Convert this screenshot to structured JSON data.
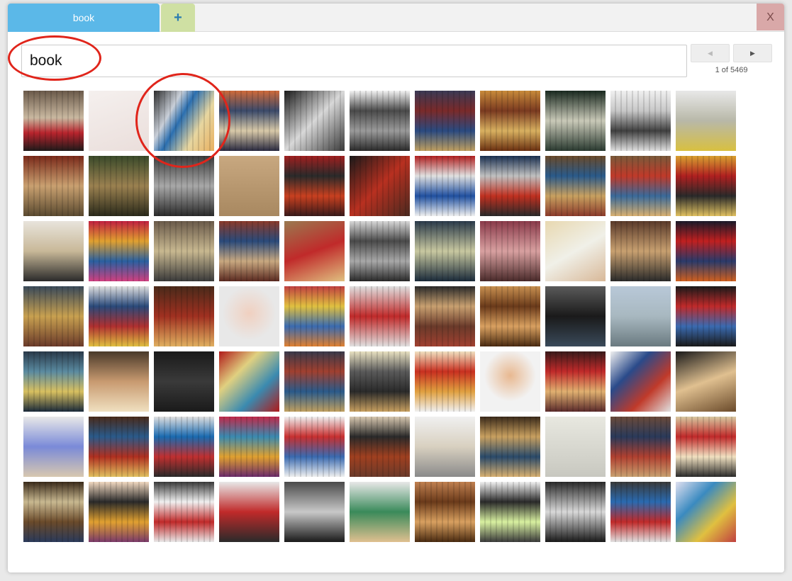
{
  "tabs": {
    "active_label": "book",
    "add_label": "+"
  },
  "close_label": "X",
  "search": {
    "value": "book",
    "placeholder": ""
  },
  "pagination": {
    "prev_label": "◀",
    "next_label": "▶",
    "counter": "1 of 5469"
  },
  "thumbnails": [
    {
      "bg": "linear-gradient(180deg,#6b5a4a 0%,#c9b8a0 45%,#b8242d 70%,#1f1a1a 100%)"
    },
    {
      "bg": "linear-gradient(160deg,#f5f0ee,#eadedb)",
      "plain": true
    },
    {
      "bg": "linear-gradient(120deg,#2a2a2a 0%,#c9cfd8 30%,#2b6fb0 45%,#e7d6a0 70%,#e8b060 100%)"
    },
    {
      "bg": "linear-gradient(180deg,#cf6a3a,#3b4a6a,#d8c9a8,#2a2a40)"
    },
    {
      "bg": "linear-gradient(135deg,#1a1a1a,#d8d8d8,#3a3a3a)"
    },
    {
      "bg": "linear-gradient(180deg,#f2f2f2,#4a4a4a,#9a9a9a,#2a2a2a)"
    },
    {
      "bg": "linear-gradient(180deg,#3b3a55,#7a2a2a,#2a4a80,#c0a060)"
    },
    {
      "bg": "linear-gradient(180deg,#c88a3a,#7a3a20,#d8b060,#6a3010)"
    },
    {
      "bg": "linear-gradient(180deg,#1a2a20,#c9c9b8,#2a3a30)"
    },
    {
      "bg": "linear-gradient(180deg,#f0f0f0,#c8c8c8,#404040,#e0e0e0)"
    },
    {
      "bg": "linear-gradient(180deg,#e8e8e8,#b8b8a8,#d8c040)",
      "plain": true
    },
    {
      "bg": "linear-gradient(180deg,#7a2a1a,#c9a070,#5a4a30)"
    },
    {
      "bg": "linear-gradient(180deg,#3a4a2a,#9a8050,#2a2a1a)"
    },
    {
      "bg": "linear-gradient(180deg,#3a3a3a,#a8a8a8,#2a2a2a)"
    },
    {
      "bg": "linear-gradient(180deg,#c8a880,#a88860)",
      "plain": true
    },
    {
      "bg": "linear-gradient(180deg,#a02020,#2a2a2a,#c84020,#3a1a1a)"
    },
    {
      "bg": "linear-gradient(135deg,#1a1a1a,#b83020,#4a2a20)"
    },
    {
      "bg": "linear-gradient(180deg,#b02020,#e0e0e0,#2050a0,#f0f0f0)"
    },
    {
      "bg": "linear-gradient(180deg,#1a3050,#c0c0c0,#c03020,#2a2a2a)"
    },
    {
      "bg": "linear-gradient(180deg,#6a4a2a,#2a5a8a,#c8a060,#8a3a2a)"
    },
    {
      "bg": "linear-gradient(180deg,#7a5a3a,#c03a2a,#3a6a9a,#d8b070)"
    },
    {
      "bg": "linear-gradient(180deg,#d8a030,#b02020,#2a2a2a,#e0c060)"
    },
    {
      "bg": "linear-gradient(180deg,#e8e4dc,#c8b898,#2a2a2a)",
      "plain": true
    },
    {
      "bg": "linear-gradient(180deg,#c02040,#e0a030,#2a60a0,#d04080)"
    },
    {
      "bg": "linear-gradient(180deg,#6a5a4a,#c8b890,#3a3a3a)"
    },
    {
      "bg": "linear-gradient(180deg,#8a3a2a,#2a4a7a,#c8a880,#5a2a20)"
    },
    {
      "bg": "linear-gradient(160deg,#9a7a50,#c02a2a,#e0c080)",
      "plain": true
    },
    {
      "bg": "linear-gradient(180deg,#d8d8d8,#4a4a4a,#a8a8a8,#2a2a2a)"
    },
    {
      "bg": "linear-gradient(180deg,#2a3a4a,#c8c8a0,#1a2a3a)"
    },
    {
      "bg": "linear-gradient(180deg,#8a3a4a,#d8a0a0,#4a2a2a)"
    },
    {
      "bg": "linear-gradient(150deg,#e8d8b0,#f0f0e8,#d8b898)",
      "plain": true
    },
    {
      "bg": "linear-gradient(180deg,#5a3a2a,#c8a070,#2a2a2a)"
    },
    {
      "bg": "linear-gradient(180deg,#1a1a2a,#c02020,#2a3a6a,#d06020)"
    },
    {
      "bg": "linear-gradient(180deg,#3a4a5a,#c8a050,#6a3a2a)"
    },
    {
      "bg": "linear-gradient(180deg,#e0e0e0,#2a4a7a,#b03030,#e0c040)"
    },
    {
      "bg": "linear-gradient(180deg,#4a2a1a,#a03020,#e0b060)"
    },
    {
      "bg": "radial-gradient(circle at 50% 45%,#f0d0c0 0%,#e8e8e8 60%)",
      "plain": true
    },
    {
      "bg": "linear-gradient(180deg,#c04040,#e0c040,#3a6ab0,#e08030)"
    },
    {
      "bg": "linear-gradient(180deg,#e0e0e0,#c02a2a,#e0e0e0)"
    },
    {
      "bg": "linear-gradient(180deg,#2a2a2a,#c8a070,#6a3a2a,#a04030)"
    },
    {
      "bg": "linear-gradient(180deg,#c89050,#6a3a1a,#d8a060,#4a2a10)"
    },
    {
      "bg": "linear-gradient(180deg,#5a5a5a,#1a1a1a,#3a4a5a)",
      "plain": true
    },
    {
      "bg": "linear-gradient(180deg,#b8c8d8,#a8b8c0,#6a7a80)",
      "plain": true
    },
    {
      "bg": "linear-gradient(180deg,#1a1a1a,#c02a2a,#3a6ab0,#1a1a1a)"
    },
    {
      "bg": "linear-gradient(180deg,#2a3a4a,#5a8aa0,#d8c060,#1a2a3a)"
    },
    {
      "bg": "linear-gradient(180deg,#4a3a2a,#c89a70,#f0e0c0)",
      "plain": true
    },
    {
      "bg": "linear-gradient(180deg,#1a1a1a,#3a3a3a,#1a1a1a)",
      "plain": true
    },
    {
      "bg": "linear-gradient(135deg,#b01a1a,#e0d080,#3a8ab0,#b01a1a)",
      "plain": true
    },
    {
      "bg": "linear-gradient(180deg,#3a3a4a,#a04030,#2a5a8a,#c0a060)"
    },
    {
      "bg": "linear-gradient(180deg,#e8e0c0,#5a5a5a,#2a2a2a,#c8a060)"
    },
    {
      "bg": "linear-gradient(180deg,#f0e0c0,#c83020,#e0a040,#f0f0f0)"
    },
    {
      "bg": "radial-gradient(circle at 50% 40%,#e8b890 0%,#f2f2f2 55%)",
      "plain": true
    },
    {
      "bg": "linear-gradient(180deg,#3a1a1a,#c02a2a,#e0b070,#5a2a2a)"
    },
    {
      "bg": "linear-gradient(135deg,#f0f0f0,#2a4a8a,#c03a2a,#e0e0e0)",
      "plain": true
    },
    {
      "bg": "linear-gradient(160deg,#1a1a1a,#e0c090,#6a4a2a)",
      "plain": true
    },
    {
      "bg": "linear-gradient(180deg,#e8e8e8,#7a8ad8,#d8c8b0)",
      "plain": true
    },
    {
      "bg": "linear-gradient(180deg,#4a2a1a,#2a5a8a,#b03020,#e0c060)"
    },
    {
      "bg": "linear-gradient(180deg,#e0e0e0,#1a6ab0,#c03030,#2a2a2a)"
    },
    {
      "bg": "linear-gradient(180deg,#c02a4a,#3a8ab0,#e0a030,#6a2a6a)"
    },
    {
      "bg": "linear-gradient(180deg,#f0f0f0,#c83030,#3a6ab0,#f0f0f0)"
    },
    {
      "bg": "linear-gradient(180deg,#d8c8b0,#2a2a2a,#a04020,#6a3a2a)"
    },
    {
      "bg": "linear-gradient(180deg,#f0f0f0,#d8d0c0,#8a8a8a)",
      "plain": true
    },
    {
      "bg": "linear-gradient(180deg,#3a2a1a,#c8a060,#2a4a6a,#d8b070)"
    },
    {
      "bg": "linear-gradient(180deg,#e8e8e0,#c8c8c0)",
      "plain": true
    },
    {
      "bg": "linear-gradient(180deg,#6a4a3a,#2a3a5a,#b04030,#c8a070)"
    },
    {
      "bg": "linear-gradient(180deg,#d8c8a0,#c02a2a,#f0e0c0,#2a2a2a)"
    },
    {
      "bg": "linear-gradient(180deg,#3a2a1a,#c8b890,#6a4a2a,#2a3a5a)"
    },
    {
      "bg": "linear-gradient(180deg,#f0d8c0,#2a2a2a,#e0a030,#7a3a6a)"
    },
    {
      "bg": "linear-gradient(180deg,#3a3a3a,#f0f0f0,#c02a2a,#e8e8e8)"
    },
    {
      "bg": "linear-gradient(180deg,#e8e8e8,#c02a2a,#2a2a2a)",
      "plain": true
    },
    {
      "bg": "linear-gradient(180deg,#4a4a4a,#c8c8c8,#1a1a1a)",
      "plain": true
    },
    {
      "bg": "linear-gradient(180deg,#e8e8e8,#3a8a5a,#e0c090)",
      "plain": true
    },
    {
      "bg": "linear-gradient(180deg,#c08050,#6a3a1a,#d8a060,#4a2a10)"
    },
    {
      "bg": "linear-gradient(180deg,#f0f0f0,#2a2a2a,#d8f0a0,#3a3a3a)"
    },
    {
      "bg": "linear-gradient(180deg,#2a2a2a,#d8d8d8,#1a1a1a)"
    },
    {
      "bg": "linear-gradient(180deg,#3a3a3a,#2a6ab0,#c02a2a,#e0e0e0)"
    },
    {
      "bg": "linear-gradient(135deg,#e0e0f0,#3a8ac0,#e0c040,#c04040)",
      "plain": true
    }
  ]
}
